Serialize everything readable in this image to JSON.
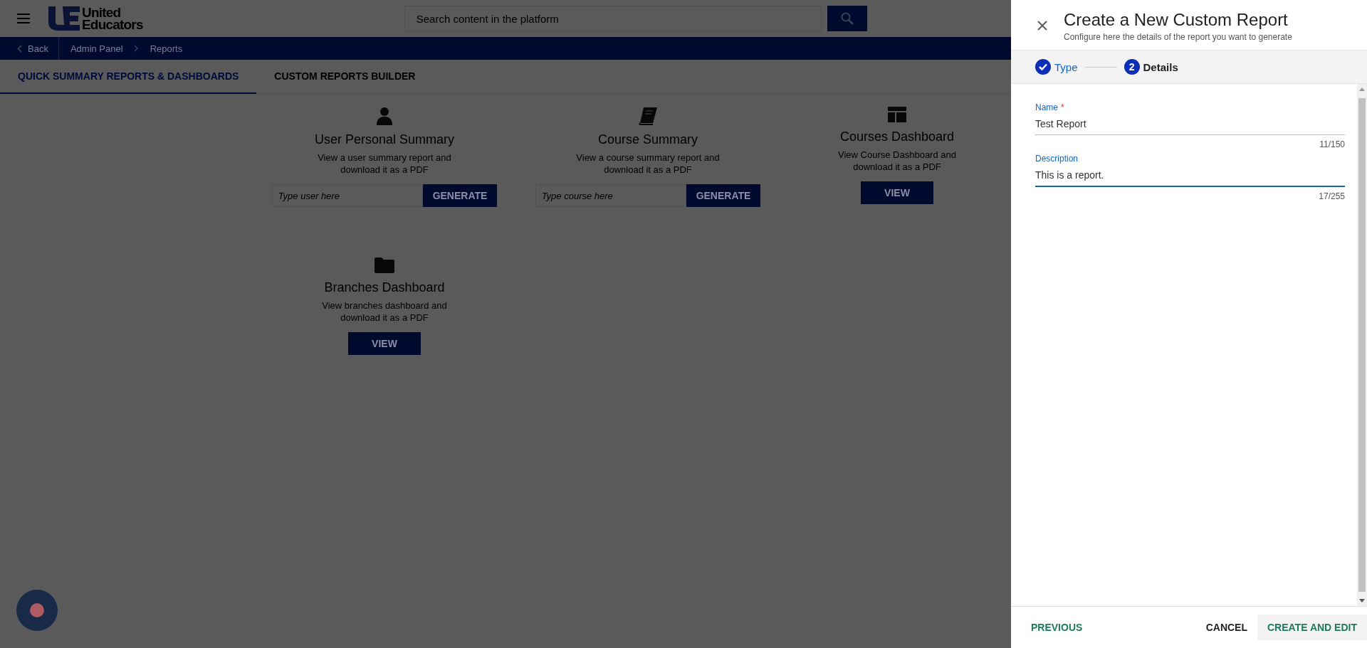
{
  "header": {
    "logo": {
      "line1": "United",
      "line2": "Educators"
    },
    "search": {
      "placeholder": "Search content in the platform"
    }
  },
  "breadcrumb": {
    "back": "Back",
    "items": [
      "Admin Panel",
      "Reports"
    ]
  },
  "tabs": [
    {
      "label": "QUICK SUMMARY REPORTS & DASHBOARDS",
      "selected": true
    },
    {
      "label": "CUSTOM REPORTS BUILDER",
      "selected": false
    }
  ],
  "cards": [
    {
      "kind": "input",
      "title": "User Personal Summary",
      "description": "View a user summary report and download it as a PDF",
      "placeholder": "Type user here",
      "button": "GENERATE"
    },
    {
      "kind": "input",
      "title": "Course Summary",
      "description": "View a course summary report and download it as a PDF",
      "placeholder": "Type course here",
      "button": "GENERATE"
    },
    {
      "kind": "view",
      "title": "Courses Dashboard",
      "description": "View Course Dashboard and download it as a PDF",
      "button": "VIEW"
    },
    {
      "kind": "view",
      "title": "Branches Dashboard",
      "description": "View branches dashboard and download it as a PDF",
      "button": "VIEW"
    }
  ],
  "panel": {
    "title": "Create a New Custom Report",
    "subtitle": "Configure here the details of the report you want to generate",
    "steps": [
      {
        "label": "Type",
        "done": true,
        "selected": false
      },
      {
        "label": "Details",
        "number": "2",
        "done": false,
        "selected": true
      }
    ],
    "fields": [
      {
        "label": "Name",
        "required": "*",
        "value": "Test Report",
        "counter": "11/150",
        "focused": false
      },
      {
        "label": "Description",
        "value": "This is a report.",
        "counter": "17/255",
        "focused": true
      }
    ],
    "footer": {
      "previous": "PREVIOUS",
      "cancel": "CANCEL",
      "submit": "CREATE AND EDIT"
    }
  }
}
